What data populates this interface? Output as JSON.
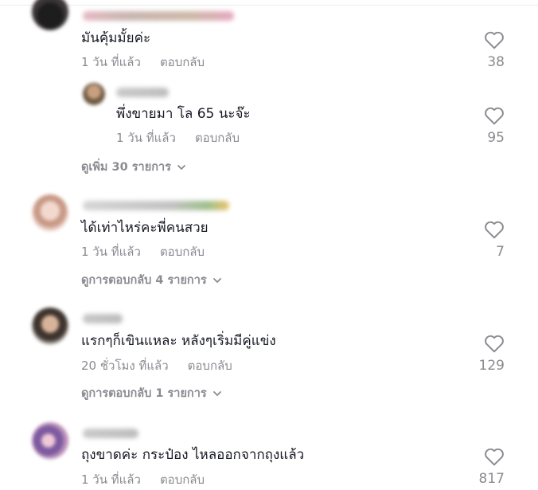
{
  "icons": {
    "like": "heart-outline-icon",
    "expand": "chevron-down-icon"
  },
  "colors": {
    "text": "#161823",
    "muted": "#8a8b91"
  },
  "comments": [
    {
      "text": "มันคุ้มมั้ยค่ะ",
      "time": "1 วัน ที่แล้ว",
      "reply": "ตอบกลับ",
      "likes": "38"
    },
    {
      "text": "พึ่งขายมา โล 65 นะจ๊ะ",
      "time": "1 วัน ที่แล้ว",
      "reply": "ตอบกลับ",
      "likes": "95",
      "view_more": "ดูเพิ่ม 30 รายการ"
    },
    {
      "text": "ได้เท่าไหร่คะพี่คนสวย",
      "time": "1 วัน ที่แล้ว",
      "reply": "ตอบกลับ",
      "likes": "7",
      "view_more": "ดูการตอบกลับ 4 รายการ"
    },
    {
      "text": "แรกๆก็เขินแหละ หลังๆเริ่มมีคู่แข่ง",
      "time": "20 ชั่วโมง ที่แล้ว",
      "reply": "ตอบกลับ",
      "likes": "129",
      "view_more": "ดูการตอบกลับ 1 รายการ"
    },
    {
      "text": "ถุงขาดค่ะ กระป๋อง ไหลออกจากถุงแล้ว",
      "time": "1 วัน ที่แล้ว",
      "reply": "ตอบกลับ",
      "likes": "817"
    }
  ]
}
